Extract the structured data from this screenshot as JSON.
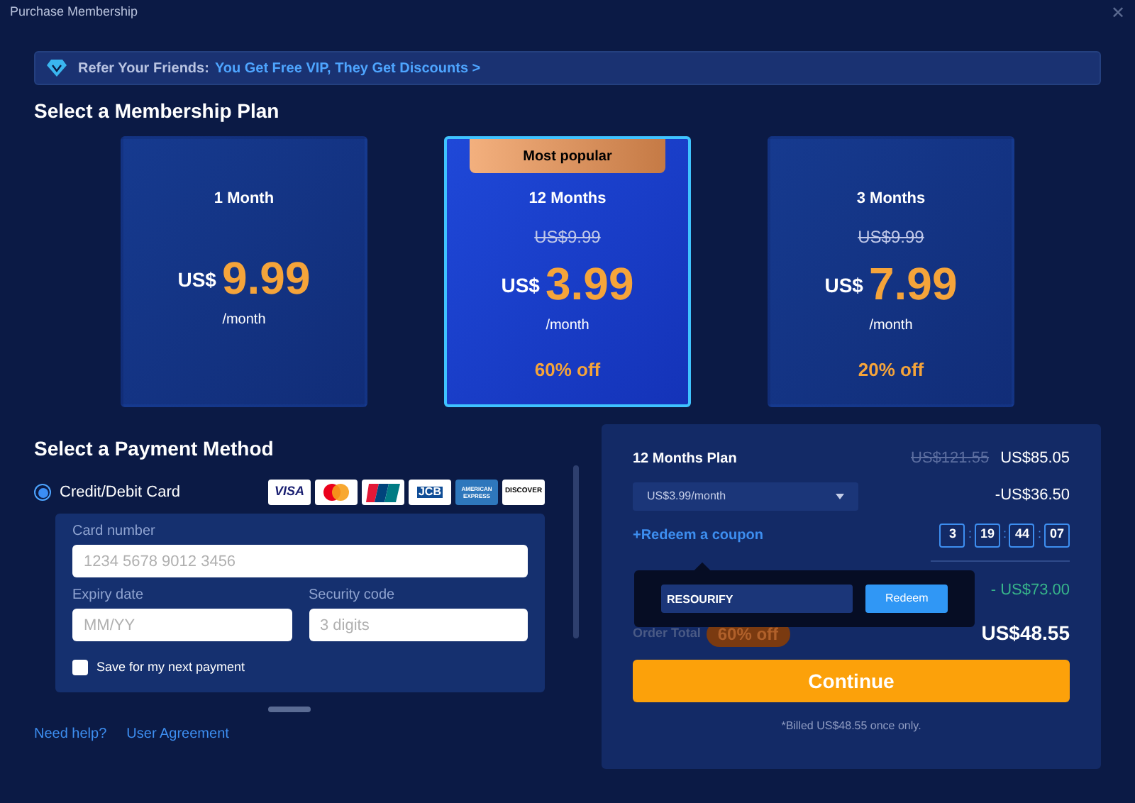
{
  "window": {
    "title": "Purchase Membership",
    "close": "✕"
  },
  "referral": {
    "lead": "Refer Your Friends:",
    "link": "You Get Free VIP, They Get Discounts >"
  },
  "plans_heading": "Select a Membership Plan",
  "plans": [
    {
      "name": "1 Month",
      "currency": "US$",
      "price": "9.99",
      "unit": "/month",
      "selected": false
    },
    {
      "name": "12 Months",
      "badge": "Most popular",
      "old_price": "US$9.99",
      "currency": "US$",
      "price": "3.99",
      "unit": "/month",
      "discount": "60% off",
      "selected": true
    },
    {
      "name": "3 Months",
      "old_price": "US$9.99",
      "currency": "US$",
      "price": "7.99",
      "unit": "/month",
      "discount": "20% off",
      "selected": false
    }
  ],
  "payment_heading": "Select a Payment Method",
  "payment": {
    "label": "Credit/Debit Card",
    "selected": true,
    "logos": [
      {
        "kind": "visa",
        "label": "VISA"
      },
      {
        "kind": "mastercard"
      },
      {
        "kind": "unionpay"
      },
      {
        "kind": "jcb",
        "label": "JCB"
      },
      {
        "kind": "amex",
        "label": "AMERICAN EXPRESS"
      },
      {
        "kind": "discover",
        "label": "DISCOVER"
      }
    ],
    "card_number": {
      "label": "Card number",
      "placeholder": "1234 5678 9012 3456"
    },
    "expiry": {
      "label": "Expiry date",
      "placeholder": "MM/YY"
    },
    "security": {
      "label": "Security code",
      "placeholder": "3 digits"
    },
    "save": {
      "label": "Save for my next payment",
      "checked": false
    }
  },
  "links": [
    "Need help?",
    "User Agreement"
  ],
  "summary": {
    "plan": "12 Months Plan",
    "old_total": "US$121.55",
    "plan_total": "US$85.05",
    "option": "US$3.99/month",
    "plan_discount": "-US$36.50",
    "coupon_link": "+Redeem a coupon",
    "timer": [
      "3",
      "19",
      "44",
      "07"
    ],
    "timer_separator": ":",
    "coupon_discount": "- US$73.00",
    "order_label": "Order Total",
    "order_badge": "60% off",
    "order_total": "US$48.55",
    "continue": "Continue",
    "note": "*Billed US$48.55 once only."
  },
  "coupon_popup": {
    "value": "RESOURIFY",
    "button": "Redeem"
  }
}
